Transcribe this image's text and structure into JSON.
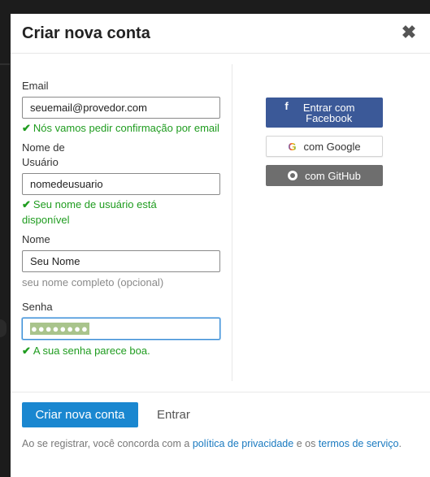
{
  "modal": {
    "title": "Criar nova conta",
    "close_symbol": "✖"
  },
  "form": {
    "email": {
      "label": "Email",
      "value": "seuemail@provedor.com",
      "message": "Nós vamos pedir confirmação por email"
    },
    "username": {
      "label": "Nome de Usuário",
      "value": "nomedeusuario",
      "message": "Seu nome de usuário está disponível"
    },
    "name": {
      "label": "Nome",
      "value": "Seu Nome",
      "hint": "seu nome completo (opcional)"
    },
    "password": {
      "label": "Senha",
      "value": "●●●●●●●●",
      "message": "A sua senha parece boa."
    },
    "check_symbol": "✔"
  },
  "social": {
    "facebook": {
      "icon": "f",
      "label": "Entrar com Facebook",
      "color": "#3b5998"
    },
    "google": {
      "icon": "G",
      "label": "com Google"
    },
    "github": {
      "label": "com GitHub",
      "color": "#6e6e6e"
    }
  },
  "footer": {
    "create_button": "Criar nova conta",
    "login_link": "Entrar",
    "terms_prefix": "Ao se registrar, você concorda com a ",
    "privacy_link": "política de privacidade",
    "terms_middle": " e os ",
    "terms_link": "termos de serviço",
    "terms_suffix": "."
  },
  "colors": {
    "accent": "#1a87d0",
    "success": "#1f9c1f"
  }
}
